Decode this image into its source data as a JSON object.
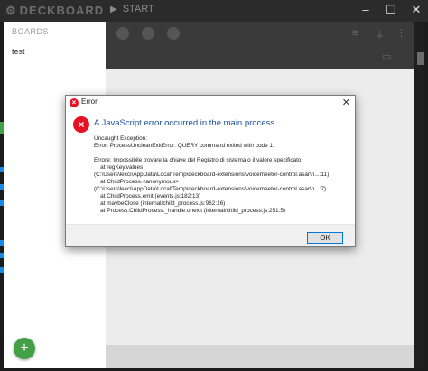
{
  "app": {
    "logo_text": "DECKBOARD",
    "start_label": "START",
    "window_controls": [
      "minimize-icon",
      "maximize-icon",
      "close-icon"
    ]
  },
  "sidebar": {
    "header": "BOARDS",
    "items": [
      {
        "label": "test"
      }
    ],
    "add_button_symbol": "+"
  },
  "dialog": {
    "title": "Error",
    "close_symbol": "✕",
    "main_instruction": "A JavaScript error occurred in the main process",
    "details": "Uncaught Exception:\nError: ProcessUncleanExitError: QUERY command exited with code 1:\n\nErrore: Impossibile trovare la chiave del Registro di sistema o il valore specificato.\n    at regKey.values\n(C:\\Users\\lecci\\AppData\\Local\\Temp\\deckboard-extensions\\voicemeeter-control.asar\\n...:11)\n    at ChildProcess.<anonymous>\n(C:\\Users\\lecci\\AppData\\Local\\Temp\\deckboard-extensions\\voicemeeter-control.asar\\n...:7)\n    at ChildProcess.emit (events.js:182:13)\n    at maybeClose (internal/child_process.js:962:16)\n    at Process.ChildProcess._handle.onexit (internal/child_process.js:251:5)",
    "ok_label": "OK"
  },
  "colors": {
    "accent_green": "#43a047",
    "error_red": "#e81123",
    "instruction_blue": "#1b4f9c"
  }
}
